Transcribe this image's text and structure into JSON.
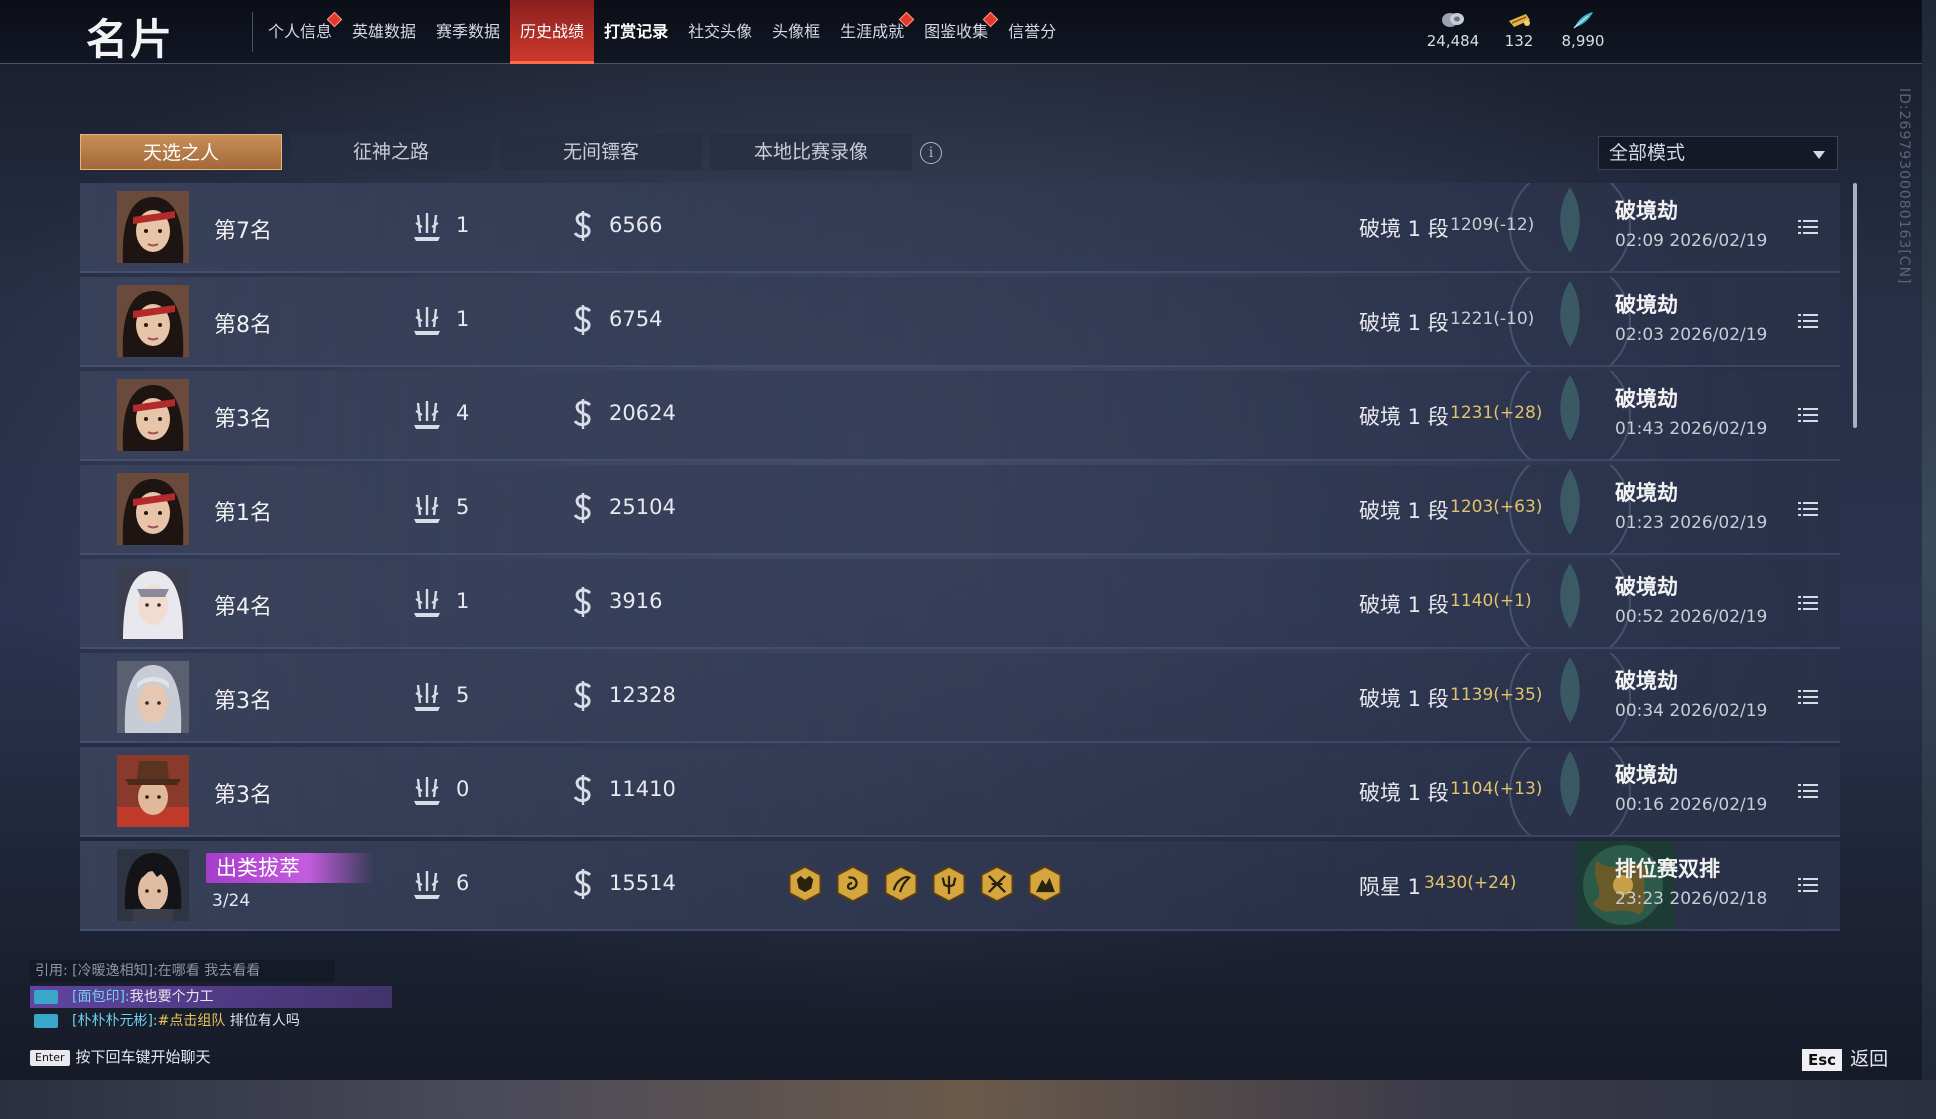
{
  "header": {
    "title": "名片",
    "tabs": [
      {
        "label": "个人信息",
        "dot": true
      },
      {
        "label": "英雄数据",
        "dot": false
      },
      {
        "label": "赛季数据",
        "dot": false
      },
      {
        "label": "历史战绩",
        "dot": false,
        "active": true
      },
      {
        "label": "打赏记录",
        "dot": false,
        "bold": true
      },
      {
        "label": "社交头像",
        "dot": false
      },
      {
        "label": "头像框",
        "dot": false
      },
      {
        "label": "生涯成就",
        "dot": true
      },
      {
        "label": "图鉴收集",
        "dot": true
      },
      {
        "label": "信誉分",
        "dot": false
      }
    ],
    "currencies": [
      {
        "icon": "coin-icon",
        "value": "24,484"
      },
      {
        "icon": "gold-ticket-icon",
        "value": "132"
      },
      {
        "icon": "feather-icon",
        "value": "8,990"
      }
    ]
  },
  "subtabs": [
    "天选之人",
    "征神之路",
    "无间镖客",
    "本地比赛录像"
  ],
  "active_subtab": 0,
  "mode_filter": "全部模式",
  "matches": [
    {
      "avatar": "female-red-band",
      "rank": "第7名",
      "kills": "1",
      "money": "6566",
      "tier": "破境 1 段",
      "score": "1209(-12)",
      "up": false,
      "mode": "破境劫",
      "time": "02:09  2026/02/19"
    },
    {
      "avatar": "female-red-band",
      "rank": "第8名",
      "kills": "1",
      "money": "6754",
      "tier": "破境 1 段",
      "score": "1221(-10)",
      "up": false,
      "mode": "破境劫",
      "time": "02:03  2026/02/19"
    },
    {
      "avatar": "female-red-band",
      "rank": "第3名",
      "kills": "4",
      "money": "20624",
      "tier": "破境 1 段",
      "score": "1231(+28)",
      "up": true,
      "mode": "破境劫",
      "time": "01:43  2026/02/19"
    },
    {
      "avatar": "female-red-band",
      "rank": "第1名",
      "kills": "5",
      "money": "25104",
      "tier": "破境 1 段",
      "score": "1203(+63)",
      "up": true,
      "mode": "破境劫",
      "time": "01:23  2026/02/19"
    },
    {
      "avatar": "white-veil",
      "rank": "第4名",
      "kills": "1",
      "money": "3916",
      "tier": "破境 1 段",
      "score": "1140(+1)",
      "up": true,
      "mode": "破境劫",
      "time": "00:52  2026/02/19"
    },
    {
      "avatar": "silver-hair",
      "rank": "第3名",
      "kills": "5",
      "money": "12328",
      "tier": "破境 1 段",
      "score": "1139(+35)",
      "up": true,
      "mode": "破境劫",
      "time": "00:34  2026/02/19"
    },
    {
      "avatar": "hat-man",
      "rank": "第3名",
      "kills": "0",
      "money": "11410",
      "tier": "破境 1 段",
      "score": "1104(+13)",
      "up": true,
      "mode": "破境劫",
      "time": "00:16  2026/02/19"
    },
    {
      "avatar": "dark-hair",
      "badge": "出类拔萃",
      "badge_sub": "3/24",
      "kills": "6",
      "money": "15514",
      "heroes": [
        "demon-mask-icon",
        "dragon-coin-icon",
        "phoenix-icon",
        "trident-icon",
        "crossed-swords-icon",
        "mountain-icon"
      ],
      "tier": "陨星 1",
      "score": "3430(+24)",
      "up": true,
      "mode": "排位赛双排",
      "time": "23:23  2026/02/18"
    }
  ],
  "chat": {
    "quote": "引用: [冷暖逸相知]:在哪看 我去看看",
    "lines": [
      {
        "name": "[面包印]:",
        "text": "我也要个力工"
      },
      {
        "name": "[朴朴朴元彬]:",
        "link": "#点击组队",
        "text": " 排位有人吗"
      }
    ],
    "enter_key": "Enter",
    "hint": "按下回车键开始聊天"
  },
  "footer": {
    "esc_key": "Esc",
    "back_label": "返回"
  },
  "side_id": "ID:26979300080163[CN]",
  "colors": {
    "accent_red": "#d13a2c",
    "subtab_gold": "#a2683a",
    "score_up": "#e2c36a",
    "badge_purple": "#a43dc9"
  }
}
